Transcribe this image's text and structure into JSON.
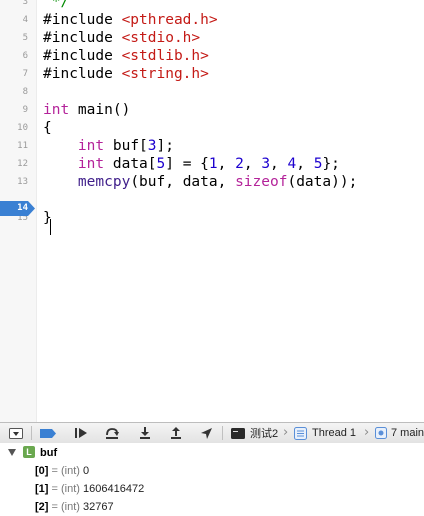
{
  "editor": {
    "lines": [
      {
        "num": "3",
        "tokens": [
          {
            "t": "cm",
            "v": " */"
          }
        ]
      },
      {
        "num": "4",
        "tokens": [
          {
            "t": "plain",
            "v": "#include "
          },
          {
            "t": "str",
            "v": "<pthread.h>"
          }
        ]
      },
      {
        "num": "5",
        "tokens": [
          {
            "t": "plain",
            "v": "#include "
          },
          {
            "t": "str",
            "v": "<stdio.h>"
          }
        ]
      },
      {
        "num": "6",
        "tokens": [
          {
            "t": "plain",
            "v": "#include "
          },
          {
            "t": "str",
            "v": "<stdlib.h>"
          }
        ]
      },
      {
        "num": "7",
        "tokens": [
          {
            "t": "plain",
            "v": "#include "
          },
          {
            "t": "str",
            "v": "<string.h>"
          }
        ]
      },
      {
        "num": "8",
        "tokens": []
      },
      {
        "num": "9",
        "tokens": [
          {
            "t": "kw",
            "v": "int"
          },
          {
            "t": "plain",
            "v": " main()"
          }
        ]
      },
      {
        "num": "10",
        "tokens": [
          {
            "t": "plain",
            "v": "{"
          }
        ]
      },
      {
        "num": "11",
        "tokens": [
          {
            "t": "plain",
            "v": "    "
          },
          {
            "t": "kw",
            "v": "int"
          },
          {
            "t": "plain",
            "v": " buf["
          },
          {
            "t": "num",
            "v": "3"
          },
          {
            "t": "plain",
            "v": "];"
          }
        ]
      },
      {
        "num": "12",
        "tokens": [
          {
            "t": "plain",
            "v": "    "
          },
          {
            "t": "kw",
            "v": "int"
          },
          {
            "t": "plain",
            "v": " data["
          },
          {
            "t": "num",
            "v": "5"
          },
          {
            "t": "plain",
            "v": "] = {"
          },
          {
            "t": "num",
            "v": "1"
          },
          {
            "t": "plain",
            "v": ", "
          },
          {
            "t": "num",
            "v": "2"
          },
          {
            "t": "plain",
            "v": ", "
          },
          {
            "t": "num",
            "v": "3"
          },
          {
            "t": "plain",
            "v": ", "
          },
          {
            "t": "num",
            "v": "4"
          },
          {
            "t": "plain",
            "v": ", "
          },
          {
            "t": "num",
            "v": "5"
          },
          {
            "t": "plain",
            "v": "};"
          }
        ]
      },
      {
        "num": "13",
        "tokens": [
          {
            "t": "plain",
            "v": "    "
          },
          {
            "t": "fn",
            "v": "memcpy"
          },
          {
            "t": "plain",
            "v": "(buf, data, "
          },
          {
            "t": "kw",
            "v": "sizeof"
          },
          {
            "t": "plain",
            "v": "(data));"
          }
        ]
      },
      {
        "num": "14",
        "tokens": [],
        "breakpoint": true
      },
      {
        "num": "15",
        "tokens": [
          {
            "t": "plain",
            "v": "}"
          }
        ]
      }
    ]
  },
  "colors": {
    "keyword": "#b4239a",
    "string": "#c41a16",
    "number": "#1c00cf",
    "comment": "#008a00",
    "breakpoint": "#3a80d3"
  },
  "toolbar": {
    "icons": [
      "hide-debug-area-icon",
      "breakpoints-toggle-icon",
      "continue-icon",
      "step-over-icon",
      "step-into-icon",
      "step-out-icon",
      "location-icon"
    ],
    "target_label": "测试2",
    "thread_label": "Thread 1",
    "frame_label": "7 main"
  },
  "variables": {
    "root": {
      "badge": "L",
      "name": "buf"
    },
    "items": [
      {
        "name": "[0]",
        "type": "(int)",
        "value": "0"
      },
      {
        "name": "[1]",
        "type": "(int)",
        "value": "1606416472"
      },
      {
        "name": "[2]",
        "type": "(int)",
        "value": "32767"
      }
    ]
  }
}
